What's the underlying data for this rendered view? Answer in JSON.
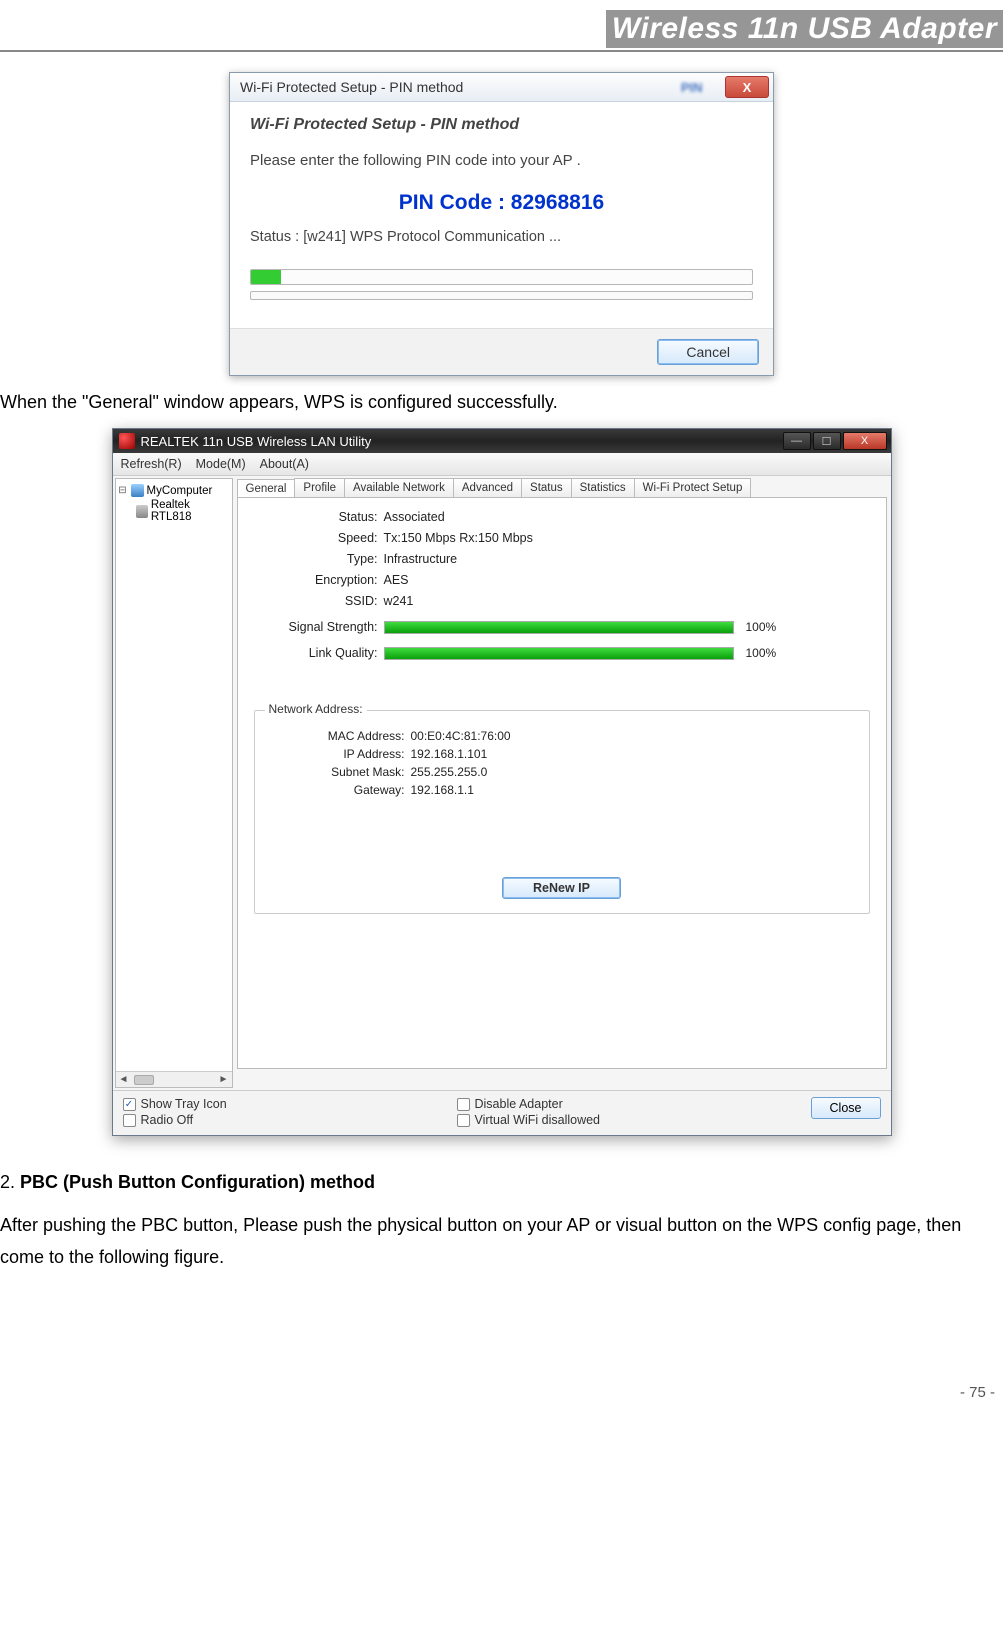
{
  "header": {
    "title": "Wireless 11n USB Adapter"
  },
  "text": {
    "line1": "When the \"General\" window appears, WPS is configured successfully.",
    "section2_prefix": "2. ",
    "section2_title": "PBC (Push Button Configuration) method",
    "section2_body": "After pushing the PBC button, Please push the physical button on your AP or visual button on the WPS config page, then come to the following figure."
  },
  "page_number": "- 75 -",
  "dialog1": {
    "title": "Wi-Fi Protected Setup - PIN method",
    "subtitle": "Wi-Fi Protected Setup - PIN method",
    "instruction": "Please enter the following PIN code into your AP .",
    "pin_label": "PIN Code :  82968816",
    "status": "Status : [w241] WPS Protocol Communication ...",
    "cancel": "Cancel",
    "close_x": "X"
  },
  "dialog2": {
    "title": "REALTEK 11n USB Wireless LAN Utility",
    "menus": [
      "Refresh(R)",
      "Mode(M)",
      "About(A)"
    ],
    "tree": {
      "root": "MyComputer",
      "child": "Realtek RTL818"
    },
    "tabs": [
      "General",
      "Profile",
      "Available Network",
      "Advanced",
      "Status",
      "Statistics",
      "Wi-Fi Protect Setup"
    ],
    "fields": {
      "status_label": "Status:",
      "status_value": "Associated",
      "speed_label": "Speed:",
      "speed_value": "Tx:150 Mbps Rx:150 Mbps",
      "type_label": "Type:",
      "type_value": "Infrastructure",
      "enc_label": "Encryption:",
      "enc_value": "AES",
      "ssid_label": "SSID:",
      "ssid_value": "w241",
      "signal_label": "Signal Strength:",
      "signal_pct": "100%",
      "link_label": "Link Quality:",
      "link_pct": "100%"
    },
    "netgroup": {
      "title": "Network Address:",
      "mac_label": "MAC Address:",
      "mac_value": "00:E0:4C:81:76:00",
      "ip_label": "IP Address:",
      "ip_value": "192.168.1.101",
      "mask_label": "Subnet Mask:",
      "mask_value": "255.255.255.0",
      "gw_label": "Gateway:",
      "gw_value": "192.168.1.1",
      "renew": "ReNew IP"
    },
    "bottom": {
      "show_tray": "Show Tray Icon",
      "radio_off": "Radio Off",
      "disable_adapter": "Disable Adapter",
      "virtual_wifi": "Virtual WiFi disallowed",
      "close": "Close"
    },
    "win_btns": {
      "min": "—",
      "max": "☐",
      "close": "X"
    }
  }
}
